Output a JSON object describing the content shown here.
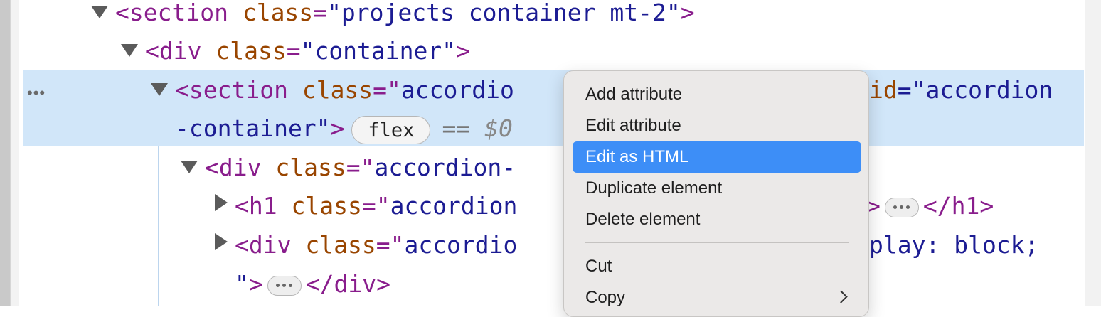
{
  "tree": {
    "line1": {
      "open": "<section",
      "attr": "class",
      "eq": "=",
      "val": "\"projects container mt-2\"",
      "close": ">"
    },
    "line2": {
      "open": "<div",
      "attr": "class",
      "eq": "=",
      "val": "\"container\"",
      "close": ">"
    },
    "line3": {
      "row_menu": "•••",
      "open": "<section",
      "attr": "class",
      "eq": "=\"",
      "val": "accordio",
      "attr_right": "id",
      "val_right": "=\"accordion"
    },
    "line4": {
      "val": "-container\"",
      "close": ">",
      "badge": "flex",
      "eqeq": "==",
      "dollar": "$0"
    },
    "line5": {
      "open": "<div",
      "attr": "class",
      "eq": "=\"",
      "val": "accordion-"
    },
    "line6": {
      "open": "<h1",
      "attr": "class",
      "eq": "=\"",
      "val": "accordion",
      "close": ">",
      "end": "</h1>"
    },
    "line7": {
      "open": "<div",
      "attr": "class",
      "eq": "=\"",
      "val": "accordio",
      "val_right": "play: block;"
    },
    "line8": {
      "val": "\"",
      "close": ">",
      "end": "</div>"
    }
  },
  "context_menu": {
    "add_attribute": "Add attribute",
    "edit_attribute": "Edit attribute",
    "edit_as_html": "Edit as HTML",
    "duplicate_element": "Duplicate element",
    "delete_element": "Delete element",
    "cut": "Cut",
    "copy": "Copy"
  }
}
